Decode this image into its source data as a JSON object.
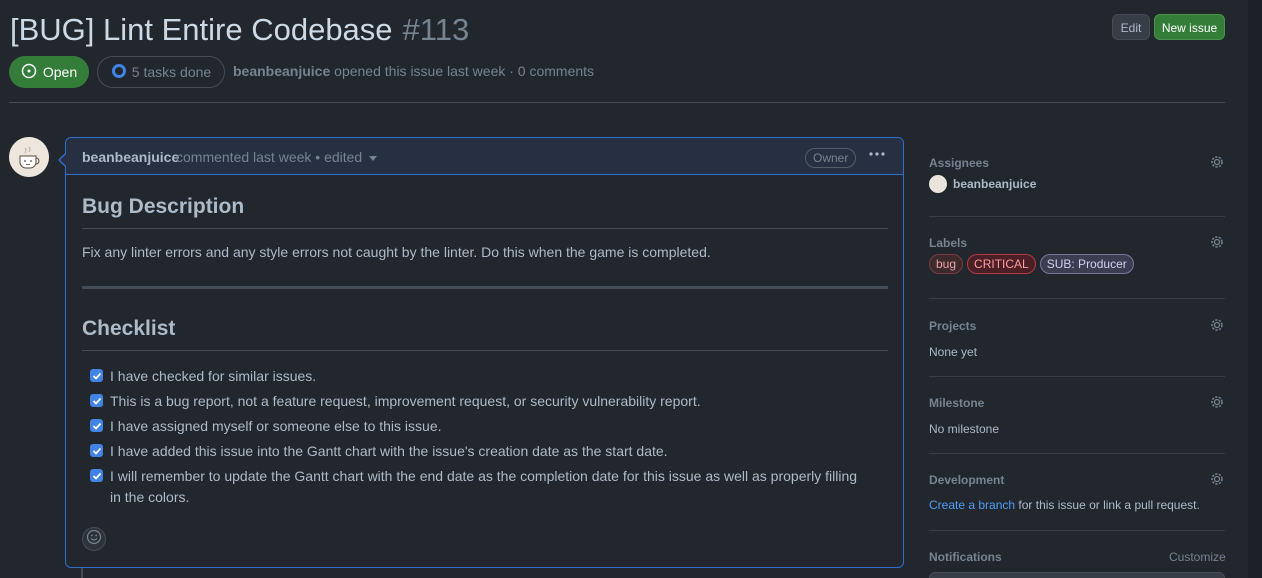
{
  "header": {
    "title": "[BUG] Lint Entire Codebase",
    "number": "#113",
    "edit_label": "Edit",
    "new_issue_label": "New issue",
    "state_label": "Open",
    "tasks_label": "5 tasks done",
    "author": "beanbeanjuice",
    "meta_text": " opened this issue last week · 0 comments"
  },
  "comment": {
    "author": "beanbeanjuice",
    "meta": "commented last week • edited",
    "owner_badge": "Owner",
    "heading_description": "Bug Description",
    "description": "Fix any linter errors and any style errors not caught by the linter. Do this when the game is completed.",
    "heading_checklist": "Checklist",
    "tasks": [
      {
        "text": "I have checked for similar issues.",
        "checked": true
      },
      {
        "text": "This is a bug report, not a feature request, improvement request, or security vulnerability report.",
        "checked": true
      },
      {
        "text": "I have assigned myself or someone else to this issue.",
        "checked": true
      },
      {
        "text": "I have added this issue into the Gantt chart with the issue's creation date as the start date.",
        "checked": true
      },
      {
        "text": "I will remember to update the Gantt chart with the end date as the completion date for this issue as well as properly filling in the colors.",
        "checked": true
      }
    ]
  },
  "sidebar": {
    "assignees": {
      "title": "Assignees",
      "name": "beanbeanjuice"
    },
    "labels": {
      "title": "Labels",
      "items": [
        {
          "name": "bug",
          "color": "#7a3a3f"
        },
        {
          "name": "CRITICAL",
          "color": "#b33a44"
        },
        {
          "name": "SUB: Producer",
          "color": "#77779a"
        }
      ]
    },
    "projects": {
      "title": "Projects",
      "value": "None yet"
    },
    "milestone": {
      "title": "Milestone",
      "value": "No milestone"
    },
    "development": {
      "title": "Development",
      "link_text": "Create a branch",
      "rest_text": " for this issue or link a pull request."
    },
    "notifications": {
      "title": "Notifications",
      "customize_label": "Customize"
    }
  },
  "colors": {
    "background": "#22272e",
    "accent_blue": "#316dca",
    "open_green": "#347d39",
    "link": "#539bf5"
  },
  "icons": [
    "issue-opened-icon",
    "progress-circle-icon",
    "kebab-icon",
    "gear-icon",
    "smiley-icon",
    "checkbox-checked-icon",
    "caret-down-icon"
  ]
}
